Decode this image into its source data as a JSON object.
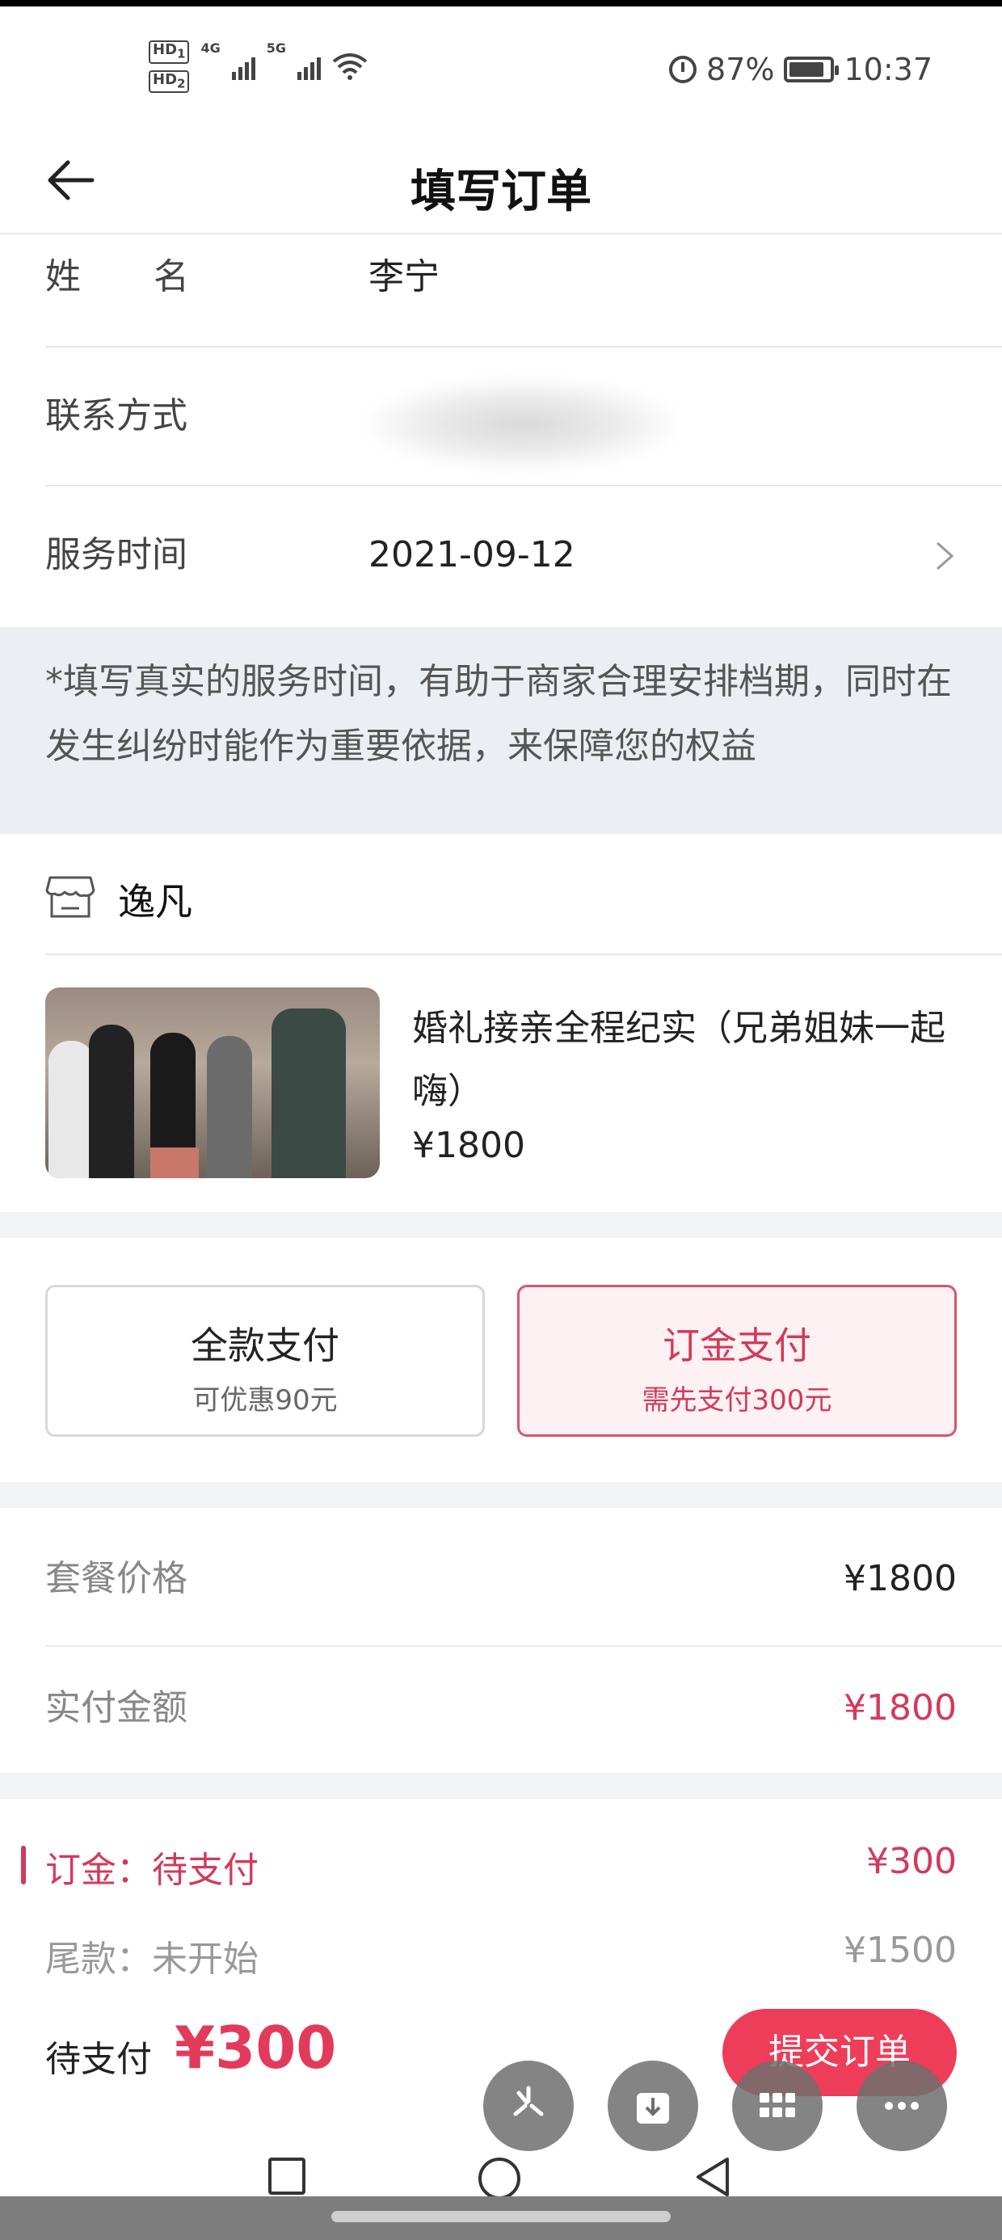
{
  "status_bar": {
    "hd1": "HD",
    "hd1_sub": "1",
    "hd2": "HD",
    "hd2_sub": "2",
    "net1": "4G",
    "net2": "5G",
    "battery": "87%",
    "battery_level": 0.87,
    "time": "10:37"
  },
  "nav": {
    "title": "填写订单"
  },
  "form": {
    "name_label": "姓名",
    "name_value": "李宁",
    "contact_label": "联系方式",
    "service_time_label": "服务时间",
    "service_time_value": "2021-09-12"
  },
  "notice": {
    "text": "*填写真实的服务时间，有助于商家合理安排档期，同时在发生纠纷时能作为重要依据，来保障您的权益"
  },
  "shop": {
    "name": "逸凡"
  },
  "product": {
    "title": "婚礼接亲全程纪实（兄弟姐妹一起嗨）",
    "price": "¥1800"
  },
  "payment_options": {
    "full": {
      "title": "全款支付",
      "subtitle": "可优惠90元"
    },
    "deposit": {
      "title": "订金支付",
      "subtitle": "需先支付300元"
    }
  },
  "summary": {
    "package_price_label": "套餐价格",
    "package_price": "¥1800",
    "actual_amount_label": "实付金额",
    "actual_amount": "¥1800"
  },
  "stages": {
    "deposit_label": "订金：待支付",
    "deposit_amount": "¥300",
    "balance_label": "尾款：未开始",
    "balance_amount": "¥1500"
  },
  "footer": {
    "pending_label": "待支付",
    "pending_amount": "¥300",
    "submit": "提交订单"
  },
  "colors": {
    "accent": "#ee3d58",
    "accent_text": "#d23a5b",
    "notice_bg": "#ebeef3"
  },
  "icons": {
    "back": "arrow-left-icon",
    "chevron": "chevron-right-icon",
    "shop": "shop-icon",
    "fab1": "sparkle-icon",
    "fab2": "download-icon",
    "fab3": "grid-icon",
    "fab4": "more-icon"
  }
}
